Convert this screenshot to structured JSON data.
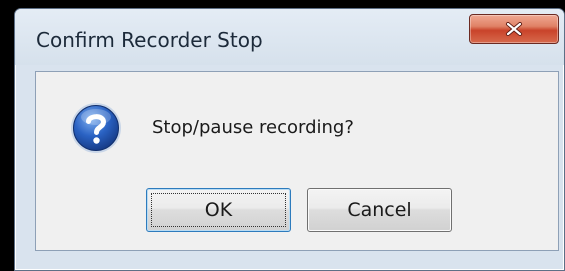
{
  "dialog": {
    "title": "Confirm Recorder Stop",
    "message": "Stop/pause recording?",
    "icon": "question-icon",
    "close_icon": "close-icon"
  },
  "buttons": {
    "ok_label": "OK",
    "cancel_label": "Cancel"
  },
  "colors": {
    "close_button": "#c9432a",
    "default_button_border": "#2d7bbd",
    "icon_blue": "#2a62c3"
  }
}
